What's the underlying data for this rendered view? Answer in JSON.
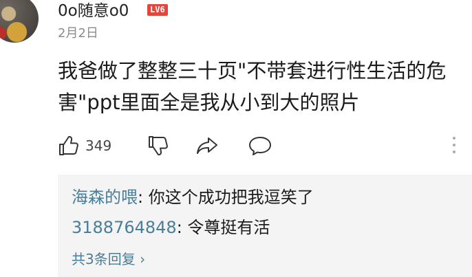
{
  "comment": {
    "username": "0o随意o0",
    "level_badge": "LV6",
    "date": "2月2日",
    "text": "我爸做了整整三十页\"不带套进行性生活的危害\"ppt里面全是我从小到大的照片",
    "like_count": "349"
  },
  "actions": {
    "like_icon": "thumbs-up-icon",
    "dislike_icon": "thumbs-down-icon",
    "share_icon": "share-arrow-icon",
    "comment_icon": "speech-bubble-icon",
    "more_icon": "vertical-dots-icon"
  },
  "replies": [
    {
      "author": "海森的喂",
      "separator": ": ",
      "text": "你这个成功把我逗笑了"
    },
    {
      "author": "3188764848",
      "separator": ": ",
      "text": "令尊挺有活"
    }
  ],
  "view_all_label": "共3条回复 ›",
  "colors": {
    "author_link": "#4a7d98",
    "badge": "#e6453c",
    "reply_background": "#f4f4f4"
  }
}
